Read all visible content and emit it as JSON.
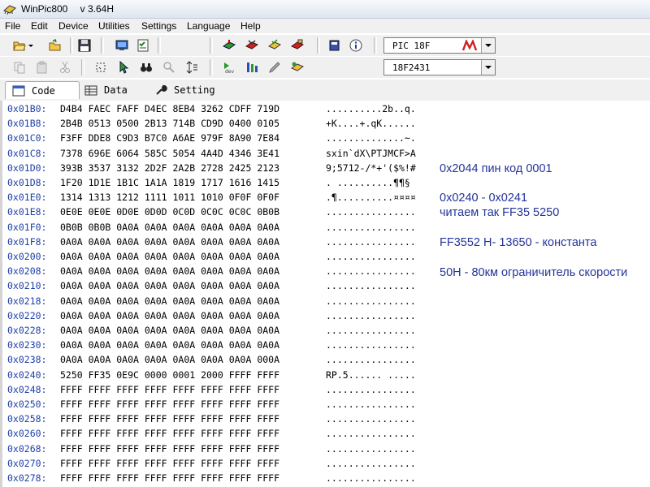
{
  "window": {
    "title": "WinPic800",
    "version": "  v 3.64H"
  },
  "menu": [
    "File",
    "Edit",
    "Device",
    "Utilities",
    "Settings",
    "Language",
    "Help"
  ],
  "device": {
    "family": "PIC 18F",
    "model": "18F2431"
  },
  "tabs": [
    "Code",
    "Data",
    "Setting"
  ],
  "rows": [
    {
      "addr": "0x01B0:",
      "data": "D4B4 FAEC FAFF D4EC 8EB4 3262 CDFF 719D",
      "ascii": "..........2b..q."
    },
    {
      "addr": "0x01B8:",
      "data": "2B4B 0513 0500 2B13 714B CD9D 0400 0105",
      "ascii": "+K....+.qK......"
    },
    {
      "addr": "0x01C0:",
      "data": "F3FF DDE8 C9D3 B7C0 A6AE 979F 8A90 7E84",
      "ascii": "..............~."
    },
    {
      "addr": "0x01C8:",
      "data": "7378 696E 6064 585C 5054 4A4D 4346 3E41",
      "ascii": "sxin`dX\\PTJMCF>A"
    },
    {
      "addr": "0x01D0:",
      "data": "393B 3537 3132 2D2F 2A2B 2728 2425 2123",
      "ascii": "9;5712-/*+'($%!#"
    },
    {
      "addr": "0x01D8:",
      "data": "1F20 1D1E 1B1C 1A1A 1819 1717 1616 1415",
      "ascii": ". ..........¶¶§"
    },
    {
      "addr": "0x01E0:",
      "data": "1314 1313 1212 1111 1011 1010 0F0F 0F0F",
      "ascii": ".¶..........¤¤¤¤"
    },
    {
      "addr": "0x01E8:",
      "data": "0E0E 0E0E 0D0E 0D0D 0C0D 0C0C 0C0C 0B0B",
      "ascii": "................"
    },
    {
      "addr": "0x01F0:",
      "data": "0B0B 0B0B 0A0A 0A0A 0A0A 0A0A 0A0A 0A0A",
      "ascii": "................"
    },
    {
      "addr": "0x01F8:",
      "data": "0A0A 0A0A 0A0A 0A0A 0A0A 0A0A 0A0A 0A0A",
      "ascii": "................"
    },
    {
      "addr": "0x0200:",
      "data": "0A0A 0A0A 0A0A 0A0A 0A0A 0A0A 0A0A 0A0A",
      "ascii": "................"
    },
    {
      "addr": "0x0208:",
      "data": "0A0A 0A0A 0A0A 0A0A 0A0A 0A0A 0A0A 0A0A",
      "ascii": "................"
    },
    {
      "addr": "0x0210:",
      "data": "0A0A 0A0A 0A0A 0A0A 0A0A 0A0A 0A0A 0A0A",
      "ascii": "................"
    },
    {
      "addr": "0x0218:",
      "data": "0A0A 0A0A 0A0A 0A0A 0A0A 0A0A 0A0A 0A0A",
      "ascii": "................"
    },
    {
      "addr": "0x0220:",
      "data": "0A0A 0A0A 0A0A 0A0A 0A0A 0A0A 0A0A 0A0A",
      "ascii": "................"
    },
    {
      "addr": "0x0228:",
      "data": "0A0A 0A0A 0A0A 0A0A 0A0A 0A0A 0A0A 0A0A",
      "ascii": "................"
    },
    {
      "addr": "0x0230:",
      "data": "0A0A 0A0A 0A0A 0A0A 0A0A 0A0A 0A0A 0A0A",
      "ascii": "................"
    },
    {
      "addr": "0x0238:",
      "data": "0A0A 0A0A 0A0A 0A0A 0A0A 0A0A 0A0A 000A",
      "ascii": "................"
    },
    {
      "addr": "0x0240:",
      "data": "5250 FF35 0E9C 0000 0001 2000 FFFF FFFF",
      "ascii": "RP.5...... ....."
    },
    {
      "addr": "0x0248:",
      "data": "FFFF FFFF FFFF FFFF FFFF FFFF FFFF FFFF",
      "ascii": "................"
    },
    {
      "addr": "0x0250:",
      "data": "FFFF FFFF FFFF FFFF FFFF FFFF FFFF FFFF",
      "ascii": "................"
    },
    {
      "addr": "0x0258:",
      "data": "FFFF FFFF FFFF FFFF FFFF FFFF FFFF FFFF",
      "ascii": "................"
    },
    {
      "addr": "0x0260:",
      "data": "FFFF FFFF FFFF FFFF FFFF FFFF FFFF FFFF",
      "ascii": "................"
    },
    {
      "addr": "0x0268:",
      "data": "FFFF FFFF FFFF FFFF FFFF FFFF FFFF FFFF",
      "ascii": "................"
    },
    {
      "addr": "0x0270:",
      "data": "FFFF FFFF FFFF FFFF FFFF FFFF FFFF FFFF",
      "ascii": "................"
    },
    {
      "addr": "0x0278:",
      "data": "FFFF FFFF FFFF FFFF FFFF FFFF FFFF FFFF",
      "ascii": "................"
    }
  ],
  "notes": [
    "0x2044 пин код 0001",
    "0x0240 - 0x0241",
    "читаем так FF35 5250",
    "FF3552 H- 13650 - константа",
    "50H - 80км ограничитель скорости"
  ]
}
